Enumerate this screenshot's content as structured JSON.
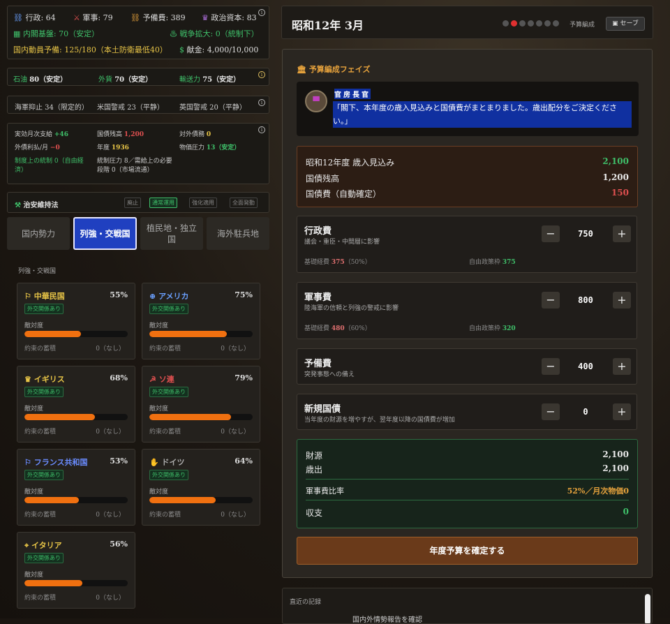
{
  "stats1": {
    "admin": "行政: 64",
    "military": "軍事: 79",
    "reserve": "予備費: 389",
    "capital": "政治資本: 83",
    "cabinet": "内閣基盤: 70（安定）",
    "war": "戦争拡大: 0（統制下）",
    "mob": "国内動員予備: 125/180（本土防衛最低40）",
    "fund_label": "献金:",
    "fund": "4,000/10,000"
  },
  "stats2": {
    "oil_label": "石油",
    "oil": "80（安定）",
    "fx_label": "外貨",
    "fx": "70（安定）",
    "ship_label": "輸送力",
    "ship": "75（安定）"
  },
  "stats3": {
    "navy": "海軍抑止 34（限定的）",
    "us": "米国警戒 23（平静）",
    "uk": "英国警戒 20（平静）"
  },
  "stats4": {
    "a_l": "実効月次支給",
    "a_v": "+46",
    "b_l": "国債残高",
    "b_v": "1,200",
    "c_l": "対外債務",
    "c_v": "0",
    "d_l": "外債利払/月",
    "d_v": "−0",
    "e_l": "年度",
    "e_v": "1936",
    "f_l": "物価圧力",
    "f_v": "13（安定）",
    "g": "制度上の統制 0（自由経済）",
    "h": "統制圧力 8／需給上の必要段階 0（市場流通）"
  },
  "security": {
    "title": "治安維持法",
    "opts": [
      "廃止",
      "通常運用",
      "強化適用",
      "全面発動"
    ]
  },
  "tabs": [
    "国内勢力",
    "列強・交戦国",
    "植民地・独立国",
    "海外駐兵地"
  ],
  "section": "列強・交戦国",
  "badge": "外交関係あり",
  "hostility": "敵対度",
  "promise": "約束の蓄積",
  "none": "0（なし）",
  "countries": [
    {
      "name": "中華民国",
      "pct": "55%",
      "level": 0.55,
      "color": "#e8c547",
      "icon": "flag-icon"
    },
    {
      "name": "アメリカ",
      "pct": "75%",
      "level": 0.75,
      "color": "#6aa0ff",
      "icon": "globe-icon"
    },
    {
      "name": "イギリス",
      "pct": "68%",
      "level": 0.68,
      "color": "#e8c547",
      "icon": "crown-icon"
    },
    {
      "name": "ソ連",
      "pct": "79%",
      "level": 0.79,
      "color": "#e05050",
      "icon": "hammer-sickle-icon"
    },
    {
      "name": "フランス共和国",
      "pct": "53%",
      "level": 0.53,
      "color": "#6a8cff",
      "icon": "flag-icon"
    },
    {
      "name": "ドイツ",
      "pct": "64%",
      "level": 0.64,
      "color": "#aaaaaa",
      "icon": "hand-icon"
    },
    {
      "name": "イタリア",
      "pct": "56%",
      "level": 0.56,
      "color": "#e8c547",
      "icon": "pin-icon"
    }
  ],
  "header": {
    "date": "昭和12年 3月",
    "phase": "予算編成",
    "save": "セーブ"
  },
  "budget": {
    "title": "予算編成フェイズ",
    "speaker": "官房長官",
    "speech": "「閣下、本年度の歳入見込みと国債費がまとまりました。歳出配分をご決定ください。」",
    "rev_l": "昭和12年度 歳入見込み",
    "rev_v": "2,100",
    "debt_l": "国債残高",
    "debt_v": "1,200",
    "int_l": "国債費（自動確定）",
    "int_v": "150"
  },
  "items": [
    {
      "title": "行政費",
      "sub": "議会・重臣・中間層に影響",
      "value": "750",
      "base": "基礎経費",
      "base_v": "375",
      "base_p": "（50%）",
      "free": "自由政策枠",
      "free_v": "375"
    },
    {
      "title": "軍事費",
      "sub": "陸海軍の信頼と列強の警戒に影響",
      "value": "800",
      "base": "基礎経費",
      "base_v": "480",
      "base_p": "（60%）",
      "free": "自由政策枠",
      "free_v": "320"
    },
    {
      "title": "予備費",
      "sub": "突発事態への備え",
      "value": "400"
    },
    {
      "title": "新規国債",
      "sub": "当年度の財源を増やすが、翌年度以降の国債費が増加",
      "value": "0"
    }
  ],
  "summary": {
    "src_l": "財源",
    "src_v": "2,100",
    "exp_l": "歳出",
    "exp_v": "2,100",
    "mil_l": "軍事費比率",
    "mil_v": "52%／月次物価0",
    "bal_l": "収支",
    "bal_v": "0"
  },
  "confirm": "年度予算を確定する",
  "log": {
    "title": "直近の記録",
    "first": "国内外情勢報告を確認"
  }
}
